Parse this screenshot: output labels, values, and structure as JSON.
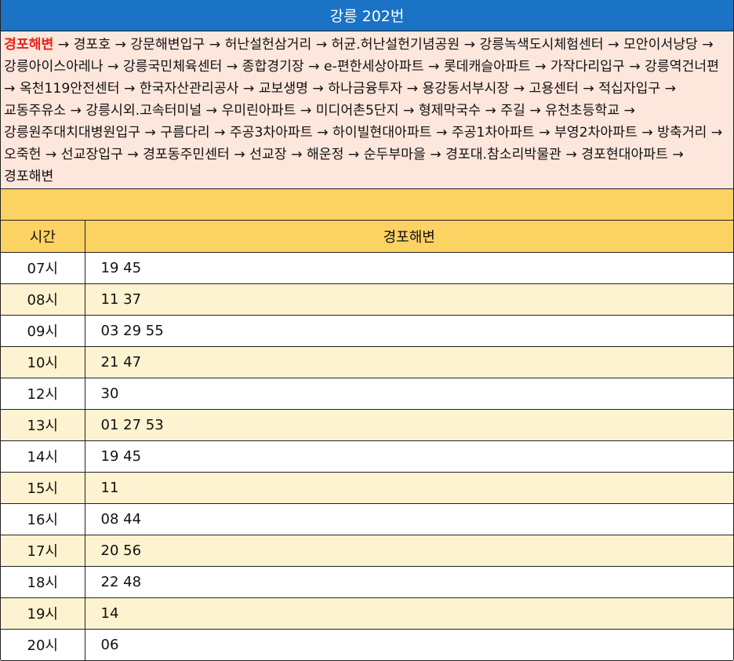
{
  "title": "강릉 202번",
  "route": {
    "start": "경포해변",
    "rest": " → 경포호 → 강문해변입구 → 허난설헌삼거리 → 허균.허난설헌기념공원 → 강릉녹색도시체험센터 → 모안이서낭당 → 강릉아이스아레나 → 강릉국민체육센터 → 종합경기장 → e-편한세상아파트 → 롯데캐슬아파트 → 가작다리입구 → 강릉역건너편 → 옥천119안전센터 → 한국자산관리공사 → 교보생명 → 하나금융투자 → 용강동서부시장 → 고용센터 → 적십자입구 → 교동주유소 → 강릉시외.고속터미널 → 우미린아파트 → 미디어촌5단지 → 형제막국수 → 주길 → 유천초등학교 → 강릉원주대치대병원입구 → 구름다리 → 주공3차아파트 → 하이빌현대아파트 → 주공1차아파트 → 부영2차아파트 → 방축거리 → 오죽헌 → 선교장입구 → 경포동주민센터 → 선교장 → 해운정 → 순두부마을 → 경포대.참소리박물관 → 경포현대아파트 → 경포해변"
  },
  "table": {
    "headers": [
      "시간",
      "경포해변"
    ],
    "rows": [
      {
        "hour": "07시",
        "mins": "19 45"
      },
      {
        "hour": "08시",
        "mins": "11 37"
      },
      {
        "hour": "09시",
        "mins": "03 29 55"
      },
      {
        "hour": "10시",
        "mins": "21 47"
      },
      {
        "hour": "12시",
        "mins": "30"
      },
      {
        "hour": "13시",
        "mins": "01 27 53"
      },
      {
        "hour": "14시",
        "mins": "19 45"
      },
      {
        "hour": "15시",
        "mins": "11"
      },
      {
        "hour": "16시",
        "mins": "08 44"
      },
      {
        "hour": "17시",
        "mins": "20 56"
      },
      {
        "hour": "18시",
        "mins": "22 48"
      },
      {
        "hour": "19시",
        "mins": "14"
      },
      {
        "hour": "20시",
        "mins": "06"
      }
    ]
  },
  "colors": {
    "title_bg": "#1a73c4",
    "route_bg": "#fde6dc",
    "start_stop": "#e8231b",
    "header_bg": "#fcd262",
    "alt_row_bg": "#fef3d0"
  }
}
